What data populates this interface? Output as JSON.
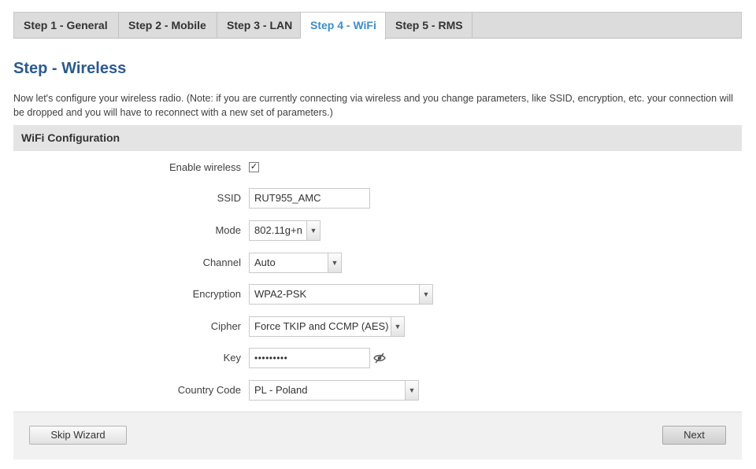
{
  "tabs": [
    {
      "label": "Step 1 - General"
    },
    {
      "label": "Step 2 - Mobile"
    },
    {
      "label": "Step 3 - LAN"
    },
    {
      "label": "Step 4 - WiFi",
      "active": true
    },
    {
      "label": "Step 5 - RMS"
    }
  ],
  "page": {
    "title": "Step - Wireless",
    "description": "Now let's configure your wireless radio. (Note: if you are currently connecting via wireless and you change parameters, like SSID, encryption, etc. your connection will be dropped and you will have to reconnect with a new set of parameters.)"
  },
  "panel": {
    "title": "WiFi Configuration",
    "fields": {
      "enable_wireless": {
        "label": "Enable wireless",
        "checked": true,
        "check_glyph": "✓"
      },
      "ssid": {
        "label": "SSID",
        "value": "RUT955_AMC"
      },
      "mode": {
        "label": "Mode",
        "value": "802.11g+n"
      },
      "channel": {
        "label": "Channel",
        "value": "Auto"
      },
      "encryption": {
        "label": "Encryption",
        "value": "WPA2-PSK"
      },
      "cipher": {
        "label": "Cipher",
        "value": "Force TKIP and CCMP (AES)"
      },
      "key": {
        "label": "Key",
        "value": "•••••••••"
      },
      "country_code": {
        "label": "Country Code",
        "value": "PL - Poland"
      }
    }
  },
  "buttons": {
    "skip": "Skip Wizard",
    "next": "Next"
  },
  "icons": {
    "dropdown": "chevron-down-icon",
    "show_password": "eye-slash-icon",
    "checkbox": "check-icon"
  },
  "colors": {
    "active_tab": "#3b8dc6",
    "title": "#2c5a8f",
    "panel_header_bg": "#e4e4e4"
  }
}
